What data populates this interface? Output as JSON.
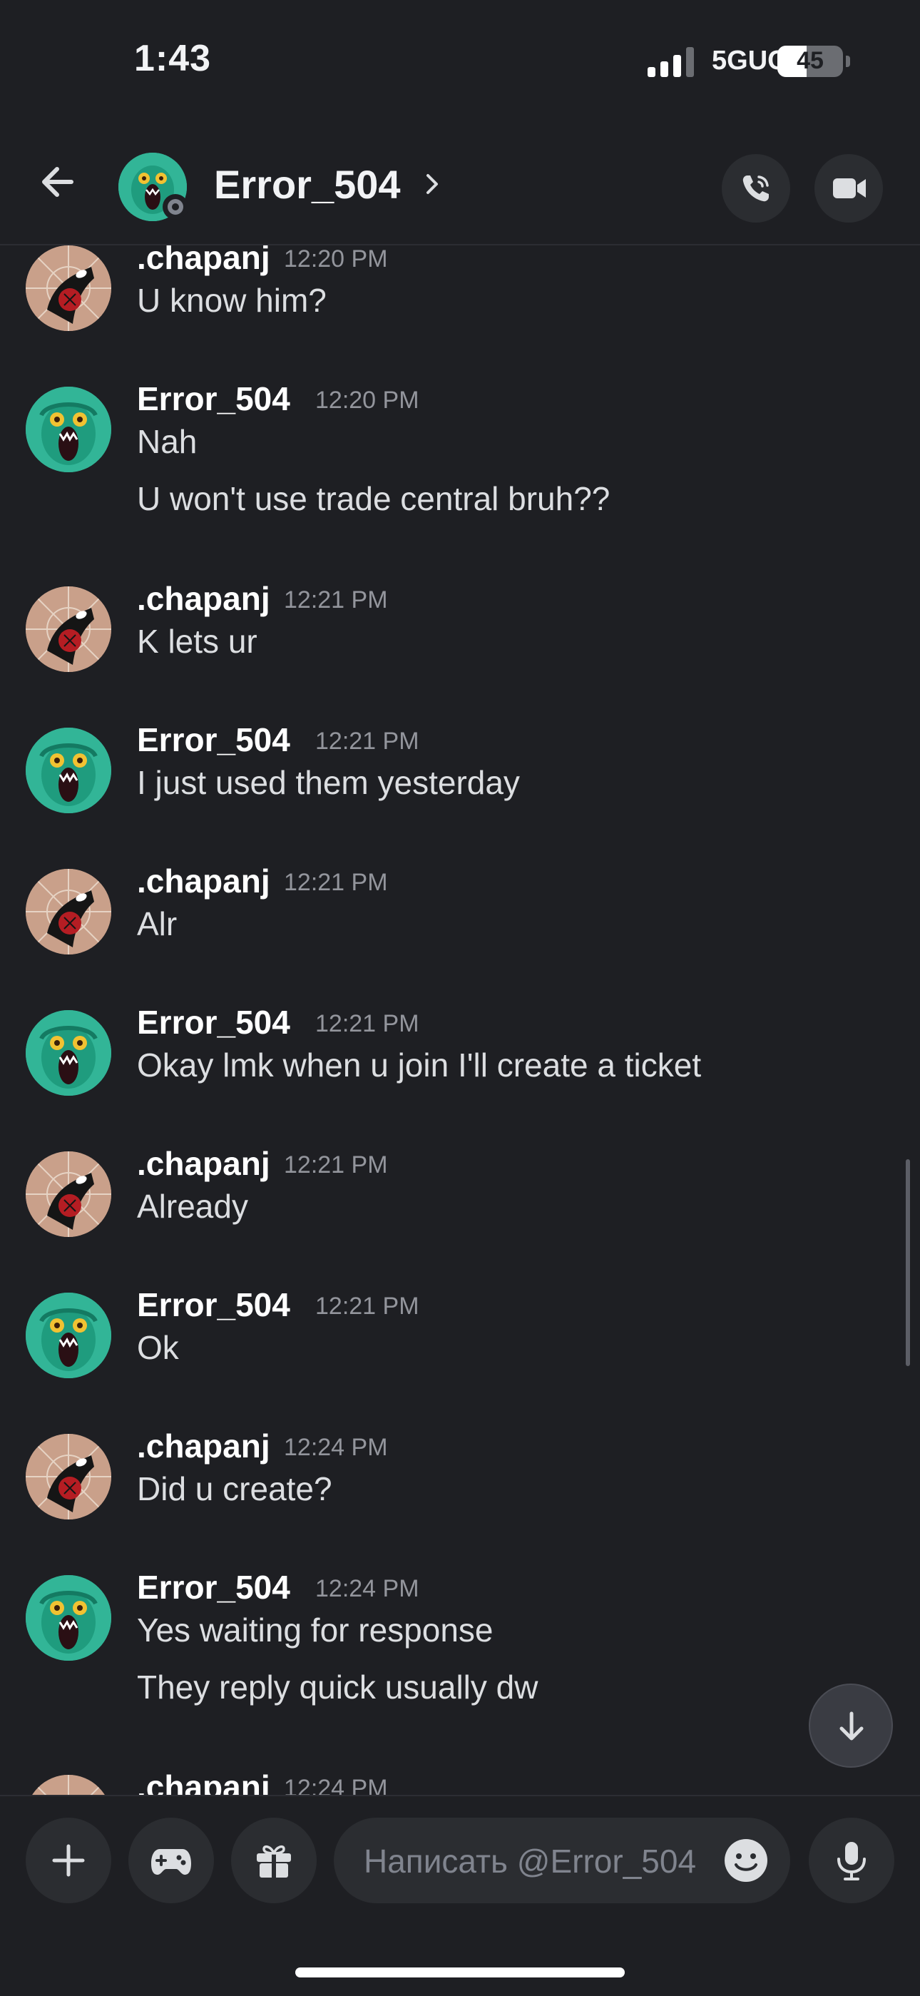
{
  "status_bar": {
    "time": "1:43",
    "network": "5GUC",
    "battery": "45",
    "battery_level": 0.45
  },
  "header": {
    "name": "Error_504"
  },
  "messages": [
    {
      "author": ".chapanj",
      "time": "12:20 PM",
      "avatar": "spider-avatar",
      "lines": [
        "U know him?"
      ]
    },
    {
      "author": "Error_504",
      "time": "12:20 PM",
      "avatar": "monster-avatar",
      "lines": [
        "Nah",
        "U won't use trade central bruh??"
      ]
    },
    {
      "author": ".chapanj",
      "time": "12:21 PM",
      "avatar": "spider-avatar",
      "lines": [
        "K lets ur"
      ]
    },
    {
      "author": "Error_504",
      "time": "12:21 PM",
      "avatar": "monster-avatar",
      "lines": [
        "I just used them yesterday"
      ]
    },
    {
      "author": ".chapanj",
      "time": "12:21 PM",
      "avatar": "spider-avatar",
      "lines": [
        "Alr"
      ]
    },
    {
      "author": "Error_504",
      "time": "12:21 PM",
      "avatar": "monster-avatar",
      "lines": [
        "Okay lmk when u join I'll create a ticket"
      ]
    },
    {
      "author": ".chapanj",
      "time": "12:21 PM",
      "avatar": "spider-avatar",
      "lines": [
        "Already"
      ]
    },
    {
      "author": "Error_504",
      "time": "12:21 PM",
      "avatar": "monster-avatar",
      "lines": [
        "Ok"
      ]
    },
    {
      "author": ".chapanj",
      "time": "12:24 PM",
      "avatar": "spider-avatar",
      "lines": [
        "Did u create?"
      ]
    },
    {
      "author": "Error_504",
      "time": "12:24 PM",
      "avatar": "monster-avatar",
      "lines": [
        "Yes waiting for response",
        "They reply quick usually dw"
      ]
    },
    {
      "author": ".chapanj",
      "time": "12:24 PM",
      "avatar": "spider-avatar",
      "lines": []
    }
  ],
  "composer": {
    "placeholder": "Написать @Error_504"
  },
  "icons": {
    "back": "arrow-left-icon",
    "call": "phone-icon",
    "video": "video-camera-icon",
    "jump": "arrow-down-icon",
    "add": "plus-icon",
    "games": "gamepad-icon",
    "gift": "gift-icon",
    "emoji": "smile-icon",
    "mic": "microphone-icon"
  },
  "colors": {
    "background": "#1e1f23",
    "surface": "#2b2d31",
    "muted": "#93959c",
    "teal": "#32b597"
  }
}
